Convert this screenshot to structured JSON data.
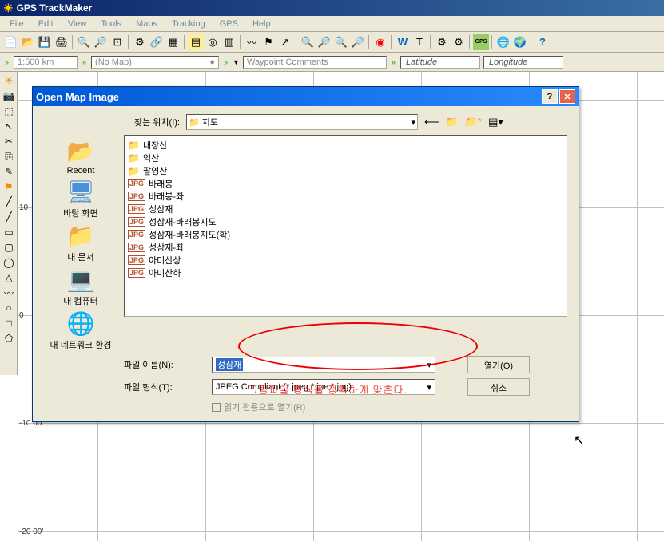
{
  "app": {
    "title": "GPS TrackMaker"
  },
  "menu": {
    "file": "File",
    "edit": "Edit",
    "view": "View",
    "tools": "Tools",
    "maps": "Maps",
    "tracking": "Tracking",
    "gps": "GPS",
    "help": "Help"
  },
  "secondbar": {
    "scale": "1:500 km",
    "map": "(No Map)",
    "comments": "Waypoint Comments",
    "lat": "Latitude",
    "lon": "Longitude"
  },
  "dialog": {
    "title": "Open Map Image",
    "lookin_label": "찾는 위치(I):",
    "lookin_value": "지도",
    "places": {
      "recent": "Recent",
      "desktop": "바탕 화면",
      "mydocs": "내 문서",
      "mycomputer": "내 컴퓨터",
      "network": "내 네트워크 환경"
    },
    "files": {
      "folders": [
        "내장산",
        "억산",
        "팔영산"
      ],
      "jpgs": [
        "바래봉",
        "바래봉-좌",
        "성삼재",
        "성삼재-바래봉지도",
        "성삼재-바래봉지도(확)",
        "성삼재-좌",
        "아미산상",
        "아미산하"
      ]
    },
    "filename_label": "파일 이름(N):",
    "filename_value": "성삼재",
    "filetype_label": "파일 형식(T):",
    "filetype_value": "JPEG Compliant (*.jpeg;*.jpe;*.jpg)",
    "readonly_label": "읽기 전용으로 열기(R)",
    "open_btn": "열기(O)",
    "cancel_btn": "취소"
  },
  "annotation": "그림파일 형식을 정확하게 맞춘다.",
  "axis": {
    "y10": "10",
    "y0": "0",
    "neg10": "-10 00'",
    "neg20": "-20 00'"
  }
}
